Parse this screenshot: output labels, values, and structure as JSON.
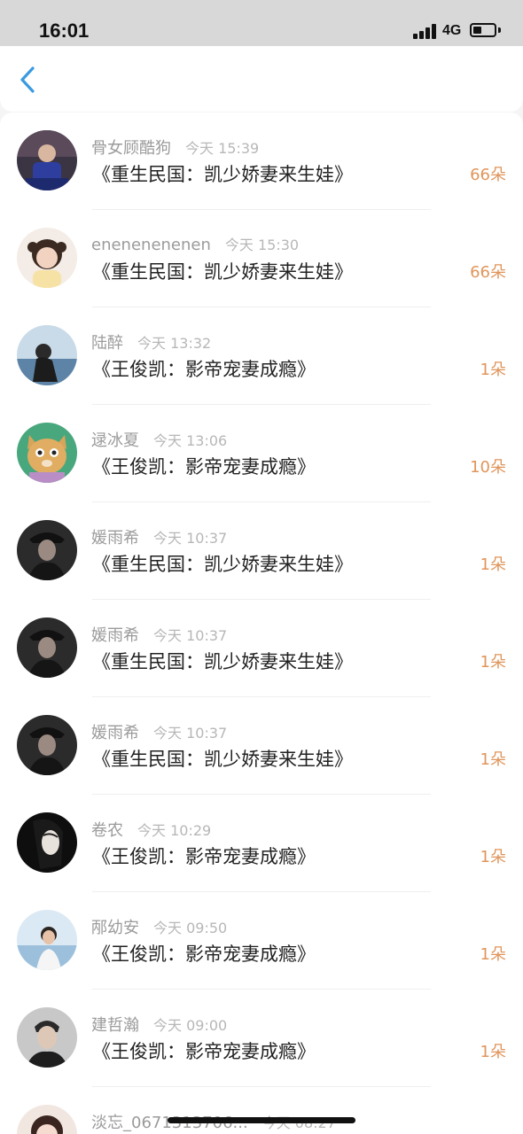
{
  "status_bar": {
    "time": "16:01",
    "network": "4G"
  },
  "nav": {
    "back_icon": "chevron-left-icon",
    "accent_color": "#3a9be0"
  },
  "colors": {
    "count": "#e0955b",
    "meta": "#9b9b9b",
    "title": "#222222"
  },
  "entries": [
    {
      "user": "骨女顾酷狗",
      "time": "今天 15:39",
      "book": "《重生民国：凯少娇妻来生娃》",
      "count": "66朵",
      "avatar": "avatar-photo-icon"
    },
    {
      "user": "enenenenenen",
      "time": "今天 15:30",
      "book": "《重生民国：凯少娇妻来生娃》",
      "count": "66朵",
      "avatar": "avatar-photo-icon"
    },
    {
      "user": "陆醉",
      "time": "今天 13:32",
      "book": "《王俊凯：影帝宠妻成瘾》",
      "count": "1朵",
      "avatar": "avatar-photo-icon"
    },
    {
      "user": "逯冰夏",
      "time": "今天 13:06",
      "book": "《王俊凯：影帝宠妻成瘾》",
      "count": "10朵",
      "avatar": "cat-avatar-icon"
    },
    {
      "user": "媛雨希",
      "time": "今天 10:37",
      "book": "《重生民国：凯少娇妻来生娃》",
      "count": "1朵",
      "avatar": "avatar-photo-icon"
    },
    {
      "user": "媛雨希",
      "time": "今天 10:37",
      "book": "《重生民国：凯少娇妻来生娃》",
      "count": "1朵",
      "avatar": "avatar-photo-icon"
    },
    {
      "user": "媛雨希",
      "time": "今天 10:37",
      "book": "《重生民国：凯少娇妻来生娃》",
      "count": "1朵",
      "avatar": "avatar-photo-icon"
    },
    {
      "user": "卷农",
      "time": "今天 10:29",
      "book": "《王俊凯：影帝宠妻成瘾》",
      "count": "1朵",
      "avatar": "avatar-photo-icon"
    },
    {
      "user": "邴幼安",
      "time": "今天 09:50",
      "book": "《王俊凯：影帝宠妻成瘾》",
      "count": "1朵",
      "avatar": "avatar-photo-icon"
    },
    {
      "user": "建哲瀚",
      "time": "今天 09:00",
      "book": "《王俊凯：影帝宠妻成瘾》",
      "count": "1朵",
      "avatar": "avatar-photo-icon"
    },
    {
      "user": "淡忘_0671313706...",
      "time": "今天 08:27",
      "book": "",
      "count": "",
      "avatar": "avatar-photo-icon"
    }
  ]
}
